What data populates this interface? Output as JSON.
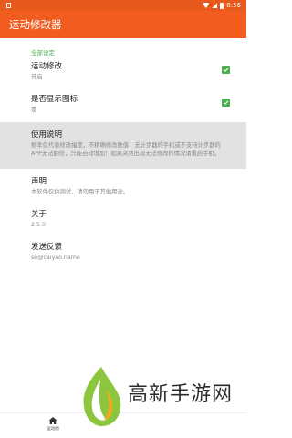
{
  "status": {
    "time": "8:56"
  },
  "app": {
    "title": "运动修改器"
  },
  "section": {
    "header": "全部设定"
  },
  "settings": [
    {
      "title": "运动修改",
      "subtitle": "开启",
      "checked": true
    },
    {
      "title": "是否显示图标",
      "subtitle": "是",
      "checked": true
    },
    {
      "title": "使用说明",
      "subtitle": "根率仅代表修改幅度，不精确修改数值，无计步器的手机或不支持计步器的APP无法翻倍，只能自动增加！如果突然出现无法修改的情况请重启手机。"
    },
    {
      "title": "声明",
      "subtitle": "本软件仅供测试，请勿用于其他用途。"
    },
    {
      "title": "关于",
      "subtitle": "2.5.0"
    },
    {
      "title": "发送反馈",
      "subtitle": "se@caiyao.name"
    }
  ],
  "bottom_nav": {
    "home_label": "运动圈"
  },
  "watermark": {
    "text": "高新手游网"
  },
  "colors": {
    "primary": "#f25c1f",
    "accent": "#4caf50"
  }
}
